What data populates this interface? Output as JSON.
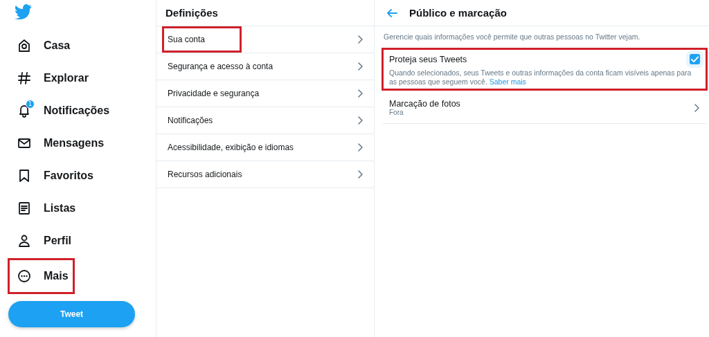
{
  "sidebar": {
    "items": [
      {
        "kind": "home",
        "label": "Casa",
        "highlighted": false
      },
      {
        "kind": "explore",
        "label": "Explorar",
        "highlighted": false
      },
      {
        "kind": "notifications",
        "label": "Notificações",
        "badge": "1",
        "highlighted": false
      },
      {
        "kind": "messages",
        "label": "Mensagens",
        "highlighted": false
      },
      {
        "kind": "bookmarks",
        "label": "Favoritos",
        "highlighted": false
      },
      {
        "kind": "lists",
        "label": "Listas",
        "highlighted": false
      },
      {
        "kind": "profile",
        "label": "Perfil",
        "highlighted": false
      },
      {
        "kind": "more",
        "label": "Mais",
        "highlighted": true
      }
    ],
    "tweet_button": "Tweet"
  },
  "settings": {
    "title": "Definições",
    "items": [
      {
        "label": "Sua conta",
        "highlighted": true
      },
      {
        "label": "Segurança e acesso à conta",
        "highlighted": false
      },
      {
        "label": "Privacidade e segurança",
        "highlighted": false
      },
      {
        "label": "Notificações",
        "highlighted": false
      },
      {
        "label": "Acessibilidade, exibição e idiomas",
        "highlighted": false
      },
      {
        "label": "Recursos adicionais",
        "highlighted": false
      }
    ]
  },
  "detail": {
    "title": "Público e marcação",
    "description": "Gerencie quais informações você permite que outras pessoas no Twitter vejam.",
    "options": [
      {
        "kind": "checkbox",
        "label": "Proteja seus Tweets",
        "checked": true,
        "highlighted": true,
        "note": "Quando selecionados, seus Tweets e outras informações da conta ficam visíveis apenas para as pessoas que seguem você.",
        "link": "Saber mais"
      },
      {
        "kind": "link",
        "label": "Marcação de fotos",
        "value": "Fora",
        "highlighted": false
      }
    ]
  }
}
